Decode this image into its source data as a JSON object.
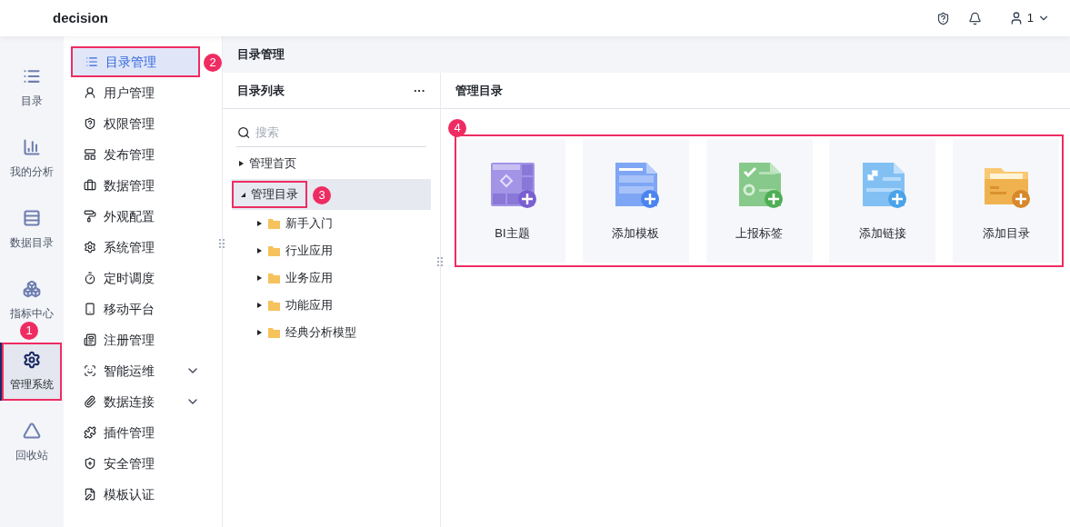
{
  "header": {
    "title": "decision",
    "user": "1"
  },
  "rail": [
    {
      "label": "目录",
      "selected": false
    },
    {
      "label": "我的分析",
      "selected": false
    },
    {
      "label": "数据目录",
      "selected": false
    },
    {
      "label": "指标中心",
      "selected": false
    },
    {
      "label": "管理系统",
      "selected": true,
      "callout": "1"
    },
    {
      "label": "回收站",
      "selected": false
    }
  ],
  "sidebar": [
    {
      "label": "目录管理",
      "selected": true,
      "callout": "2"
    },
    {
      "label": "用户管理",
      "selected": false
    },
    {
      "label": "权限管理",
      "selected": false
    },
    {
      "label": "发布管理",
      "selected": false
    },
    {
      "label": "数据管理",
      "selected": false
    },
    {
      "label": "外观配置",
      "selected": false
    },
    {
      "label": "系统管理",
      "selected": false
    },
    {
      "label": "定时调度",
      "selected": false
    },
    {
      "label": "移动平台",
      "selected": false
    },
    {
      "label": "注册管理",
      "selected": false
    },
    {
      "label": "智能运维",
      "selected": false,
      "expandable": true
    },
    {
      "label": "数据连接",
      "selected": false,
      "expandable": true
    },
    {
      "label": "插件管理",
      "selected": false
    },
    {
      "label": "安全管理",
      "selected": false
    },
    {
      "label": "模板认证",
      "selected": false
    }
  ],
  "breadcrumb": "目录管理",
  "tree_panel": {
    "title": "目录列表",
    "more": "···",
    "search": {
      "placeholder": "搜索"
    },
    "nodes": [
      {
        "label": "管理首页",
        "selected": false,
        "expanded": false
      },
      {
        "label": "管理目录",
        "selected": true,
        "expanded": true,
        "callout": "3",
        "children": [
          {
            "label": "新手入门",
            "expanded": false
          },
          {
            "label": "行业应用",
            "expanded": false
          },
          {
            "label": "业务应用",
            "expanded": false
          },
          {
            "label": "功能应用",
            "expanded": false
          },
          {
            "label": "经典分析模型",
            "expanded": false
          }
        ]
      }
    ]
  },
  "content": {
    "title": "管理目录",
    "callout": "4",
    "tiles": [
      {
        "kind": "bi",
        "label": "BI主题"
      },
      {
        "kind": "template",
        "label": "添加模板"
      },
      {
        "kind": "report",
        "label": "上报标签"
      },
      {
        "kind": "link",
        "label": "添加链接"
      },
      {
        "kind": "folder",
        "label": "添加目录"
      }
    ]
  }
}
